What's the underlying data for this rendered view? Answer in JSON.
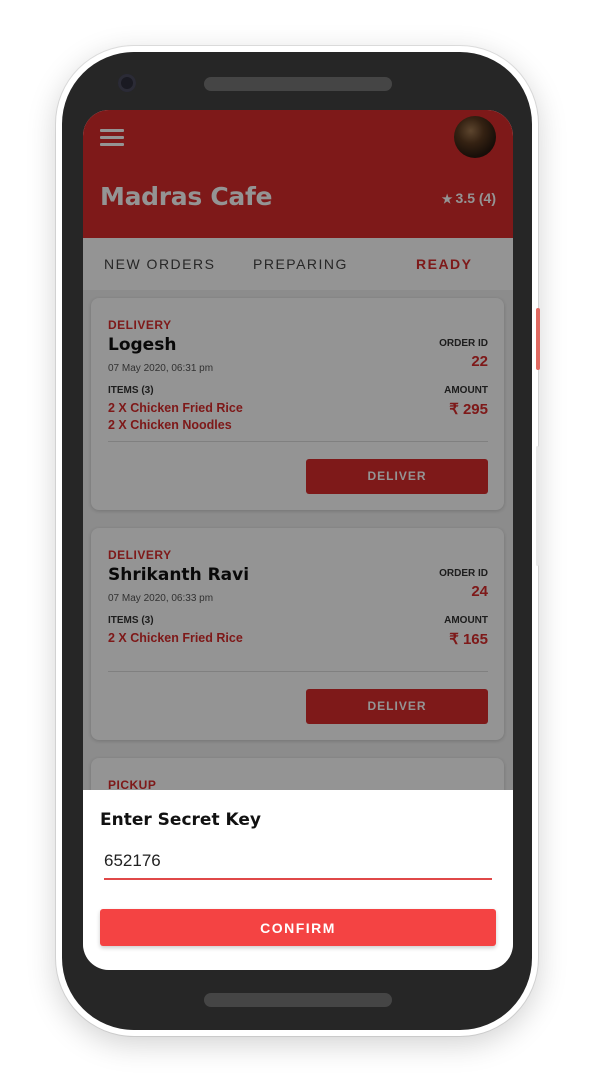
{
  "header": {
    "cafe_name": "Madras Cafe",
    "rating": "3.5 (4)",
    "star_icon": "★"
  },
  "tabs": [
    {
      "label": "NEW ORDERS"
    },
    {
      "label": "PREPARING"
    },
    {
      "label": "READY",
      "active": true
    }
  ],
  "orders": [
    {
      "type": "DELIVERY",
      "customer": "Logesh",
      "datetime": "07 May 2020, 06:31 pm",
      "items_label": "ITEMS (3)",
      "items": [
        "2 X Chicken Fried Rice",
        "2 X Chicken Noodles"
      ],
      "order_id_label": "ORDER ID",
      "order_id": "22",
      "amount_label": "AMOUNT",
      "amount": "₹ 295",
      "action": "DELIVER"
    },
    {
      "type": "DELIVERY",
      "customer": "Shrikanth Ravi",
      "datetime": "07 May 2020, 06:33 pm",
      "items_label": "ITEMS (3)",
      "items": [
        "2 X Chicken Fried Rice"
      ],
      "order_id_label": "ORDER ID",
      "order_id": "24",
      "amount_label": "AMOUNT",
      "amount": "₹ 165",
      "action": "DELIVER"
    },
    {
      "type": "PICKUP"
    }
  ],
  "dialog": {
    "title": "Enter Secret Key",
    "value": "652176",
    "confirm_label": "CONFIRM"
  },
  "colors": {
    "brand": "#d92b2b",
    "confirm": "#f44343"
  }
}
